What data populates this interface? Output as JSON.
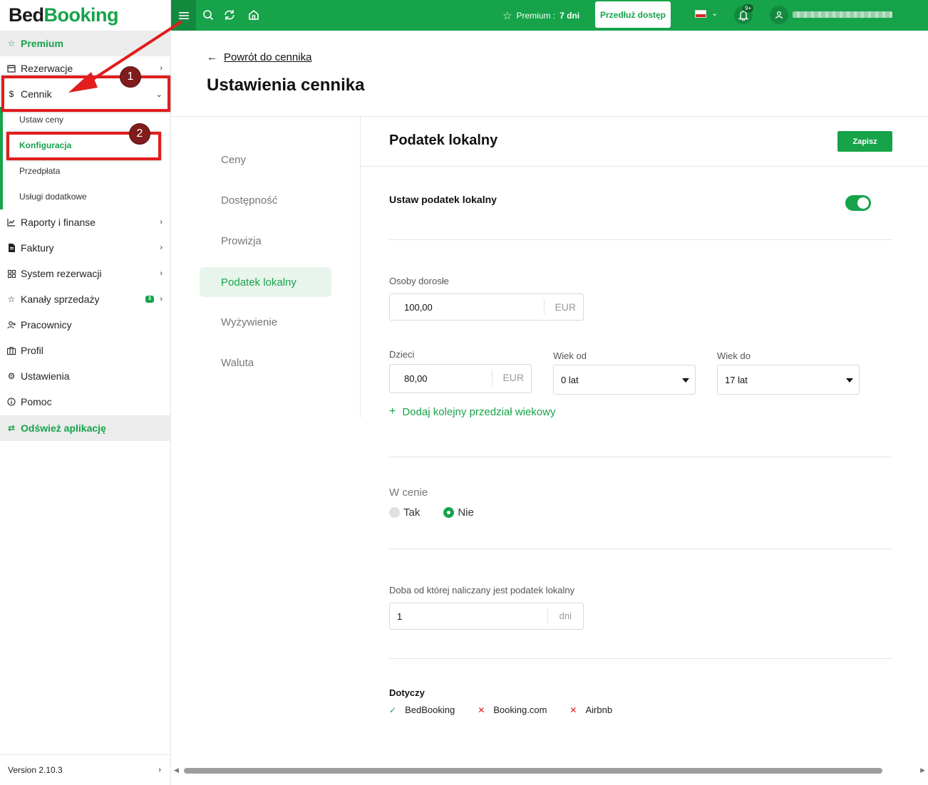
{
  "app": {
    "logo_part1": "Bed",
    "logo_part2": "Booking",
    "version": "Version 2.10.3"
  },
  "sidebar": {
    "premium": "Premium",
    "items": [
      {
        "label": "Rezerwacje",
        "icon": "calendar-icon"
      },
      {
        "label": "Cennik",
        "icon": "dollar-icon"
      },
      {
        "label": "Raporty i finanse",
        "icon": "chart-icon"
      },
      {
        "label": "Faktury",
        "icon": "invoice-icon"
      },
      {
        "label": "System rezerwacji",
        "icon": "grid-icon"
      },
      {
        "label": "Kanały sprzedaży",
        "icon": "star-icon",
        "badge": "3"
      },
      {
        "label": "Pracownicy",
        "icon": "user-plus-icon"
      },
      {
        "label": "Profil",
        "icon": "briefcase-icon"
      },
      {
        "label": "Ustawienia",
        "icon": "gear-icon"
      },
      {
        "label": "Pomoc",
        "icon": "info-icon"
      }
    ],
    "cennik_sub": [
      "Ustaw ceny",
      "Konfiguracja",
      "Przedpłata",
      "Usługi dodatkowe"
    ],
    "refresh": "Odśwież aplikację"
  },
  "annotations": {
    "step1": "1",
    "step2": "2"
  },
  "topbar": {
    "premium_label": "Premium :",
    "premium_days": "7 dni",
    "extend_button": "Przedłuż dostęp",
    "notifications_badge": "9+",
    "accent": "#16a34a"
  },
  "header": {
    "back_link": "Powrót do cennika",
    "title": "Ustawienia cennika"
  },
  "tabs": [
    "Ceny",
    "Dostępność",
    "Prowizja",
    "Podatek lokalny",
    "Wyżywienie",
    "Waluta"
  ],
  "panel": {
    "title": "Podatek lokalny",
    "save_button": "Zapisz",
    "toggle_label": "Ustaw podatek lokalny",
    "toggle_on": true,
    "adults_label": "Osoby dorosłe",
    "adults_value": "100,00",
    "children_label": "Dzieci",
    "children_value": "80,00",
    "currency": "EUR",
    "age_from_label": "Wiek od",
    "age_from_value": "0 lat",
    "age_to_label": "Wiek do",
    "age_to_value": "17 lat",
    "add_age_range": "Dodaj kolejny przedział wiekowy",
    "in_price_label": "W cenie",
    "in_price_yes": "Tak",
    "in_price_no": "Nie",
    "night_label": "Doba od której naliczany jest podatek lokalny",
    "night_value": "1",
    "night_unit": "dni",
    "applies_label": "Dotyczy",
    "applies": [
      {
        "name": "BedBooking",
        "enabled": true
      },
      {
        "name": "Booking.com",
        "enabled": false
      },
      {
        "name": "Airbnb",
        "enabled": false
      }
    ]
  }
}
